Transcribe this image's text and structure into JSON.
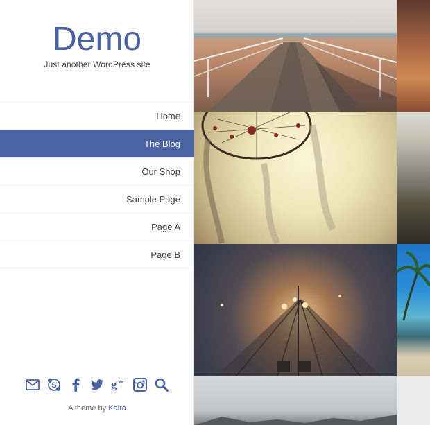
{
  "site": {
    "title": "Demo",
    "description": "Just another WordPress site"
  },
  "nav": {
    "items": [
      {
        "label": "Home",
        "active": false
      },
      {
        "label": "The Blog",
        "active": true
      },
      {
        "label": "Our Shop",
        "active": false
      },
      {
        "label": "Sample Page",
        "active": false
      },
      {
        "label": "Page A",
        "active": false
      },
      {
        "label": "Page B",
        "active": false
      }
    ]
  },
  "social_icons": [
    "email-icon",
    "skype-icon",
    "facebook-icon",
    "twitter-icon",
    "google-plus-icon",
    "instagram-icon",
    "search-icon"
  ],
  "footer": {
    "credit_prefix": "A theme by",
    "credit_link": "Kaira"
  },
  "gallery": {
    "tiles": [
      "pier-image",
      "red-image",
      "dreamcatcher-image",
      "beach-rocks-image",
      "railway-fog-image",
      "palm-beach-image",
      "sky-image",
      "white-image"
    ]
  },
  "colors": {
    "accent": "#4a63a3",
    "text": "#444444",
    "border": "#ececec"
  }
}
